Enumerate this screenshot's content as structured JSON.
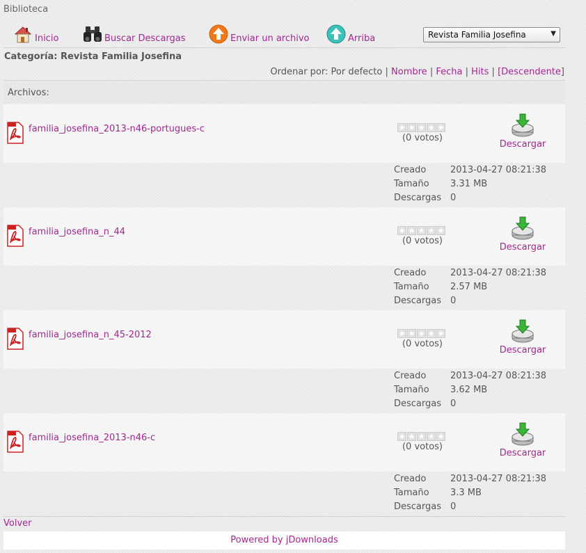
{
  "page": {
    "title": "Biblioteca"
  },
  "toolbar": {
    "home_label": "Inicio",
    "search_label": "Buscar Descargas",
    "upload_label": "Enviar un archivo",
    "up_label": "Arriba",
    "category_select": "Revista Familia Josefina"
  },
  "category": {
    "title": "Categoría: Revista Familia Josefina"
  },
  "order": {
    "prefix": "Ordenar por: Por defecto",
    "sep": "|",
    "name": "Nombre",
    "date": "Fecha",
    "hits": "Hits",
    "bracket_open": "[",
    "desc": "Descendente",
    "bracket_close": "]"
  },
  "files_header": "Archivos:",
  "labels": {
    "created": "Creado",
    "size": "Tamaño",
    "downloads": "Descargas",
    "download_button": "Descargar"
  },
  "files": [
    {
      "name": "familia_josefina_2013-n46-portugues-c",
      "votes": "(0 votos)",
      "rating": 0,
      "created": "2013-04-27 08:21:38",
      "size": "3.31 MB",
      "downloads": "0"
    },
    {
      "name": "familia_josefina_n_44",
      "votes": "(0 votos)",
      "rating": 0,
      "created": "2013-04-27 08:21:38",
      "size": "2.57 MB",
      "downloads": "0"
    },
    {
      "name": "familia_josefina_n_45-2012",
      "votes": "(0 votos)",
      "rating": 0,
      "created": "2013-04-27 08:21:38",
      "size": "3.62 MB",
      "downloads": "0"
    },
    {
      "name": "familia_josefina_2013-n46-c",
      "votes": "(0 votos)",
      "rating": 0,
      "created": "2013-04-27 08:21:38",
      "size": "3.3 MB",
      "downloads": "0"
    }
  ],
  "back_label": "Volver",
  "footer": "Powered by jDownloads",
  "colors": {
    "link": "#a0288f",
    "row_bg": "#f5f5f5",
    "page_bg": "#ececec"
  },
  "icons": {
    "home": "home-icon",
    "search": "binoculars-icon",
    "upload": "upload-arrow-icon",
    "up": "up-arrow-icon",
    "file": "pdf-icon",
    "download": "download-drive-icon"
  }
}
